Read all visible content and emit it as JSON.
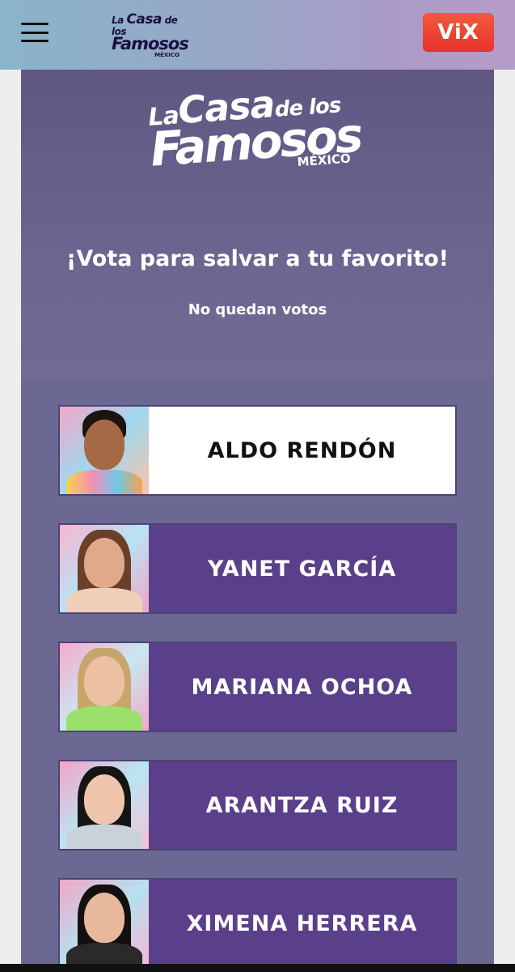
{
  "header": {
    "logo": {
      "line1_prefix": "La",
      "line1_main": "Casa",
      "line1_suffix": "de los",
      "line2": "Famosos",
      "line3": "MÉXICO"
    },
    "vix_label": "ViX",
    "colors": {
      "vix": "#e8332a",
      "bar_start": "#8ab4c9",
      "bar_end": "#b69cc8"
    }
  },
  "hero": {
    "logo": {
      "prefix": "La",
      "main": "Casa",
      "suffix": "de los",
      "line2": "Famosos",
      "line3": "MÉXICO"
    },
    "title": "¡Vota para salvar a tu favorito!",
    "subtitle": "No quedan votos"
  },
  "candidates": [
    {
      "name": "ALDO RENDÓN",
      "selected": true
    },
    {
      "name": "YANET GARCÍA",
      "selected": false
    },
    {
      "name": "MARIANA OCHOA",
      "selected": false
    },
    {
      "name": "ARANTZA RUIZ",
      "selected": false
    },
    {
      "name": "XIMENA HERRERA",
      "selected": false
    }
  ],
  "icons": {
    "menu": "hamburger-menu-icon"
  },
  "colors": {
    "panel": "#6c6894",
    "card": "#5a3f8a",
    "card_selected": "#ffffff"
  }
}
